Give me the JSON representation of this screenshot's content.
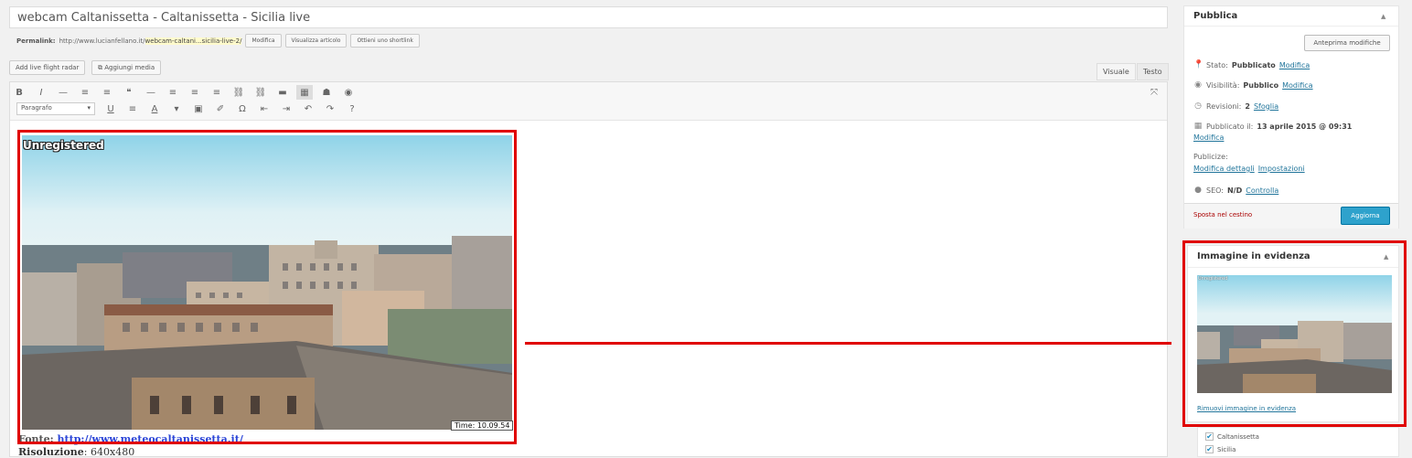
{
  "post": {
    "title": "webcam  Caltanissetta - Caltanissetta - Sicilia  live",
    "permalink_label": "Permalink:",
    "permalink_base": "http://www.lucianfellano.it/",
    "permalink_slug": "webcam-caltani...sicilia-live-2/",
    "permalink_buttons": [
      "Modifica",
      "Visualizza articolo",
      "Ottieni uno shortlink"
    ]
  },
  "media": {
    "add_form_label": "Add live flight radar",
    "add_media_label": "Aggiungi media"
  },
  "editor_tabs": [
    "Visuale",
    "Testo"
  ],
  "toolbar": {
    "row1_icons": [
      "B",
      "I",
      "—",
      "≡",
      "≡",
      "❝",
      "—",
      "≡",
      "≡",
      "≡",
      "⛓",
      "⛓",
      "▬",
      "▦",
      "☗",
      "◉"
    ],
    "row2_icons": [
      "U",
      "≡",
      "A",
      "▾",
      "▣",
      "✐",
      "Ω",
      "⇤",
      "⇥",
      "↶",
      "↷",
      "?"
    ],
    "format_select": "Paragrafo",
    "fullscreen_icon": "⤧"
  },
  "content": {
    "image_watermark": "Unregistered",
    "time_stamp": "Time: 10.09.54",
    "fonte_label": "Fonte:",
    "fonte_link": "http://www.meteocaltanissetta.it/",
    "risoluzione_label": "Risoluzione",
    "risoluzione_value": ": 640x480"
  },
  "publish": {
    "header": "Pubblica",
    "preview_button": "Anteprima modifiche",
    "status_label": "Stato:",
    "status_value": "Pubblicato",
    "visibility_label": "Visibilità:",
    "visibility_value": "Pubblico",
    "revisions_label": "Revisioni:",
    "revisions_value": "2",
    "revisions_link": "Sfoglia",
    "published_label": "Pubblicato il:",
    "published_value": "13 aprile 2015 @ 09:31",
    "publicize_label": "Publicize:",
    "publicize_links": [
      "Modifica dettagli",
      "Impostazioni"
    ],
    "seo_label": "SEO:",
    "seo_value": "N/D",
    "seo_link": "Controlla",
    "edit_link": "Modifica",
    "trash_link": "Sposta nel cestino",
    "update_button": "Aggiorna"
  },
  "featured": {
    "header": "Immagine in evidenza",
    "thumb_watermark": "Unregistered",
    "remove_link": "Rimuovi immagine in evidenza"
  },
  "categories": {
    "items": [
      "Caltanissetta",
      "Sicilia"
    ]
  },
  "colors": {
    "highlight_red": "#e00000",
    "wp_blue": "#2ea2cc",
    "link_blue": "#21759b"
  }
}
